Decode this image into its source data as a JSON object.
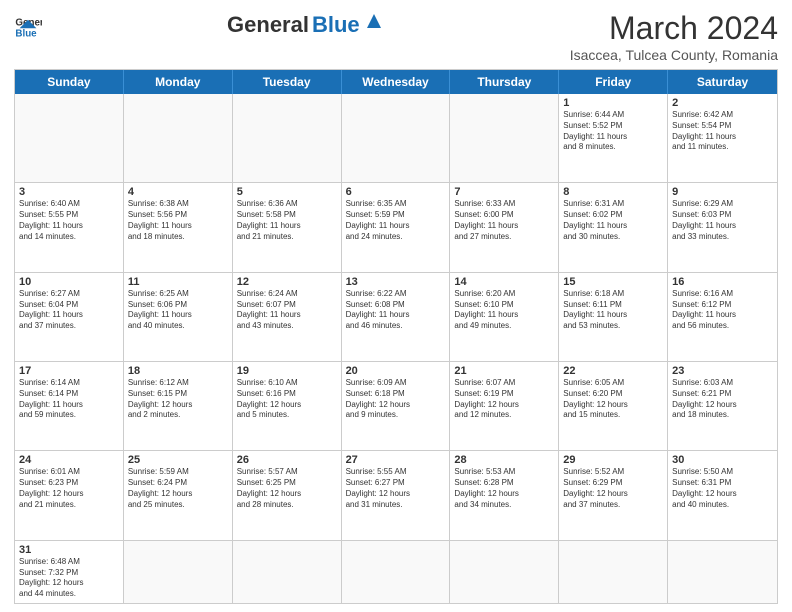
{
  "header": {
    "logo_general": "General",
    "logo_blue": "Blue",
    "month_title": "March 2024",
    "location": "Isaccea, Tulcea County, Romania"
  },
  "weekdays": [
    "Sunday",
    "Monday",
    "Tuesday",
    "Wednesday",
    "Thursday",
    "Friday",
    "Saturday"
  ],
  "rows": [
    [
      {
        "day": "",
        "text": ""
      },
      {
        "day": "",
        "text": ""
      },
      {
        "day": "",
        "text": ""
      },
      {
        "day": "",
        "text": ""
      },
      {
        "day": "",
        "text": ""
      },
      {
        "day": "1",
        "text": "Sunrise: 6:44 AM\nSunset: 5:52 PM\nDaylight: 11 hours\nand 8 minutes."
      },
      {
        "day": "2",
        "text": "Sunrise: 6:42 AM\nSunset: 5:54 PM\nDaylight: 11 hours\nand 11 minutes."
      }
    ],
    [
      {
        "day": "3",
        "text": "Sunrise: 6:40 AM\nSunset: 5:55 PM\nDaylight: 11 hours\nand 14 minutes."
      },
      {
        "day": "4",
        "text": "Sunrise: 6:38 AM\nSunset: 5:56 PM\nDaylight: 11 hours\nand 18 minutes."
      },
      {
        "day": "5",
        "text": "Sunrise: 6:36 AM\nSunset: 5:58 PM\nDaylight: 11 hours\nand 21 minutes."
      },
      {
        "day": "6",
        "text": "Sunrise: 6:35 AM\nSunset: 5:59 PM\nDaylight: 11 hours\nand 24 minutes."
      },
      {
        "day": "7",
        "text": "Sunrise: 6:33 AM\nSunset: 6:00 PM\nDaylight: 11 hours\nand 27 minutes."
      },
      {
        "day": "8",
        "text": "Sunrise: 6:31 AM\nSunset: 6:02 PM\nDaylight: 11 hours\nand 30 minutes."
      },
      {
        "day": "9",
        "text": "Sunrise: 6:29 AM\nSunset: 6:03 PM\nDaylight: 11 hours\nand 33 minutes."
      }
    ],
    [
      {
        "day": "10",
        "text": "Sunrise: 6:27 AM\nSunset: 6:04 PM\nDaylight: 11 hours\nand 37 minutes."
      },
      {
        "day": "11",
        "text": "Sunrise: 6:25 AM\nSunset: 6:06 PM\nDaylight: 11 hours\nand 40 minutes."
      },
      {
        "day": "12",
        "text": "Sunrise: 6:24 AM\nSunset: 6:07 PM\nDaylight: 11 hours\nand 43 minutes."
      },
      {
        "day": "13",
        "text": "Sunrise: 6:22 AM\nSunset: 6:08 PM\nDaylight: 11 hours\nand 46 minutes."
      },
      {
        "day": "14",
        "text": "Sunrise: 6:20 AM\nSunset: 6:10 PM\nDaylight: 11 hours\nand 49 minutes."
      },
      {
        "day": "15",
        "text": "Sunrise: 6:18 AM\nSunset: 6:11 PM\nDaylight: 11 hours\nand 53 minutes."
      },
      {
        "day": "16",
        "text": "Sunrise: 6:16 AM\nSunset: 6:12 PM\nDaylight: 11 hours\nand 56 minutes."
      }
    ],
    [
      {
        "day": "17",
        "text": "Sunrise: 6:14 AM\nSunset: 6:14 PM\nDaylight: 11 hours\nand 59 minutes."
      },
      {
        "day": "18",
        "text": "Sunrise: 6:12 AM\nSunset: 6:15 PM\nDaylight: 12 hours\nand 2 minutes."
      },
      {
        "day": "19",
        "text": "Sunrise: 6:10 AM\nSunset: 6:16 PM\nDaylight: 12 hours\nand 5 minutes."
      },
      {
        "day": "20",
        "text": "Sunrise: 6:09 AM\nSunset: 6:18 PM\nDaylight: 12 hours\nand 9 minutes."
      },
      {
        "day": "21",
        "text": "Sunrise: 6:07 AM\nSunset: 6:19 PM\nDaylight: 12 hours\nand 12 minutes."
      },
      {
        "day": "22",
        "text": "Sunrise: 6:05 AM\nSunset: 6:20 PM\nDaylight: 12 hours\nand 15 minutes."
      },
      {
        "day": "23",
        "text": "Sunrise: 6:03 AM\nSunset: 6:21 PM\nDaylight: 12 hours\nand 18 minutes."
      }
    ],
    [
      {
        "day": "24",
        "text": "Sunrise: 6:01 AM\nSunset: 6:23 PM\nDaylight: 12 hours\nand 21 minutes."
      },
      {
        "day": "25",
        "text": "Sunrise: 5:59 AM\nSunset: 6:24 PM\nDaylight: 12 hours\nand 25 minutes."
      },
      {
        "day": "26",
        "text": "Sunrise: 5:57 AM\nSunset: 6:25 PM\nDaylight: 12 hours\nand 28 minutes."
      },
      {
        "day": "27",
        "text": "Sunrise: 5:55 AM\nSunset: 6:27 PM\nDaylight: 12 hours\nand 31 minutes."
      },
      {
        "day": "28",
        "text": "Sunrise: 5:53 AM\nSunset: 6:28 PM\nDaylight: 12 hours\nand 34 minutes."
      },
      {
        "day": "29",
        "text": "Sunrise: 5:52 AM\nSunset: 6:29 PM\nDaylight: 12 hours\nand 37 minutes."
      },
      {
        "day": "30",
        "text": "Sunrise: 5:50 AM\nSunset: 6:31 PM\nDaylight: 12 hours\nand 40 minutes."
      }
    ],
    [
      {
        "day": "31",
        "text": "Sunrise: 6:48 AM\nSunset: 7:32 PM\nDaylight: 12 hours\nand 44 minutes."
      },
      {
        "day": "",
        "text": ""
      },
      {
        "day": "",
        "text": ""
      },
      {
        "day": "",
        "text": ""
      },
      {
        "day": "",
        "text": ""
      },
      {
        "day": "",
        "text": ""
      },
      {
        "day": "",
        "text": ""
      }
    ]
  ]
}
